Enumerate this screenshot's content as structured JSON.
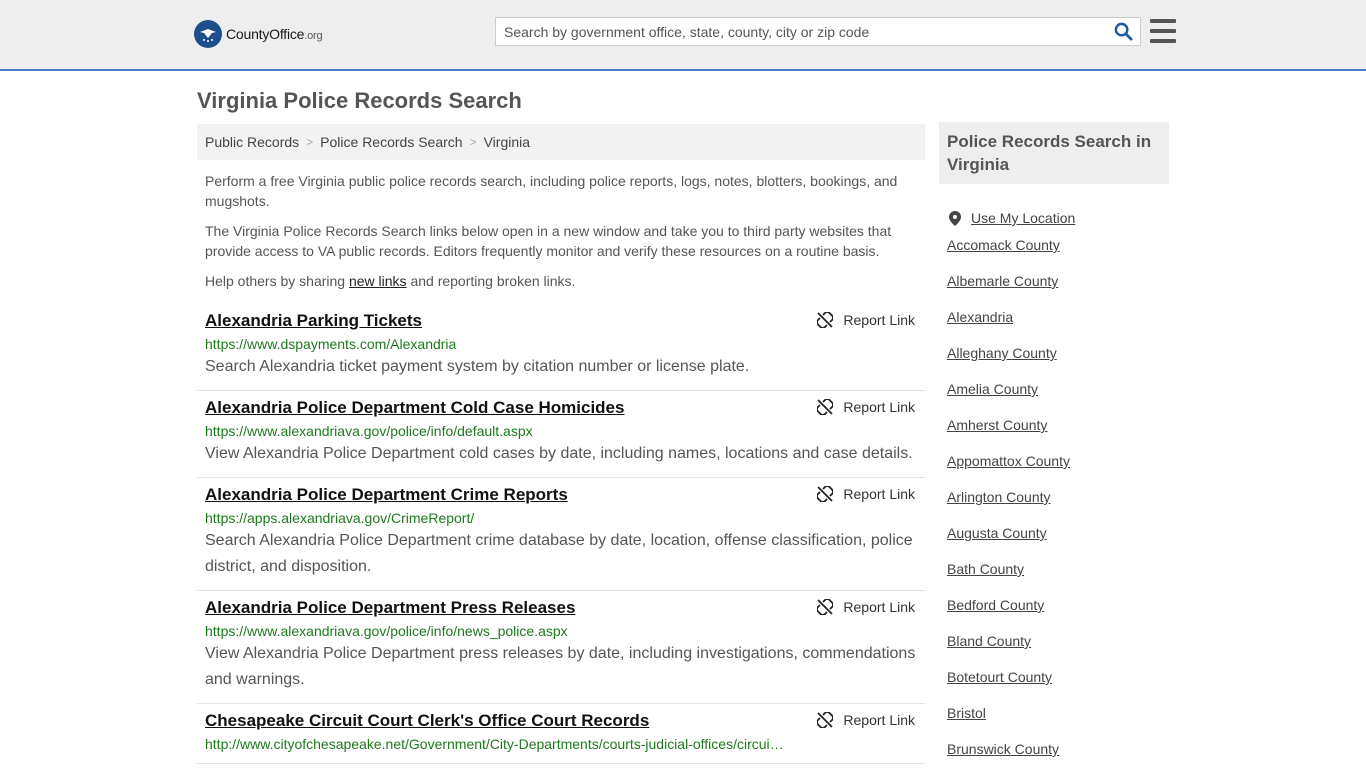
{
  "header": {
    "logo_brand": "CountyOffice",
    "logo_tld": ".org",
    "search_placeholder": "Search by government office, state, county, city or zip code"
  },
  "page_title": "Virginia Police Records Search",
  "breadcrumb": [
    "Public Records",
    "Police Records Search",
    "Virginia"
  ],
  "intro": {
    "p1": "Perform a free Virginia public police records search, including police reports, logs, notes, blotters, bookings, and mugshots.",
    "p2": "The Virginia Police Records Search links below open in a new window and take you to third party websites that provide access to VA public records. Editors frequently monitor and verify these resources on a routine basis.",
    "p3_before": "Help others by sharing ",
    "p3_link": "new links",
    "p3_after": " and reporting broken links."
  },
  "report_label": "Report Link",
  "results": [
    {
      "title": "Alexandria Parking Tickets",
      "url": "https://www.dspayments.com/Alexandria",
      "desc": "Search Alexandria ticket payment system by citation number or license plate."
    },
    {
      "title": "Alexandria Police Department Cold Case Homicides",
      "url": "https://www.alexandriava.gov/police/info/default.aspx",
      "desc": "View Alexandria Police Department cold cases by date, including names, locations and case details."
    },
    {
      "title": "Alexandria Police Department Crime Reports",
      "url": "https://apps.alexandriava.gov/CrimeReport/",
      "desc": "Search Alexandria Police Department crime database by date, location, offense classification, police district, and disposition."
    },
    {
      "title": "Alexandria Police Department Press Releases",
      "url": "https://www.alexandriava.gov/police/info/news_police.aspx",
      "desc": "View Alexandria Police Department press releases by date, including investigations, commendations and warnings."
    },
    {
      "title": "Chesapeake Circuit Court Clerk's Office Court Records",
      "url": "http://www.cityofchesapeake.net/Government/City-Departments/courts-judicial-offices/circui…",
      "desc": ""
    }
  ],
  "sidebar": {
    "title": "Police Records Search in Virginia",
    "use_location": "Use My Location",
    "items": [
      "Accomack County",
      "Albemarle County",
      "Alexandria",
      "Alleghany County",
      "Amelia County",
      "Amherst County",
      "Appomattox County",
      "Arlington County",
      "Augusta County",
      "Bath County",
      "Bedford County",
      "Bland County",
      "Botetourt County",
      "Bristol",
      "Brunswick County"
    ]
  },
  "colors": {
    "accent_border": "#4a7cc0",
    "url_green": "#1e7a1e",
    "logo_blue": "#1f4e8c"
  }
}
